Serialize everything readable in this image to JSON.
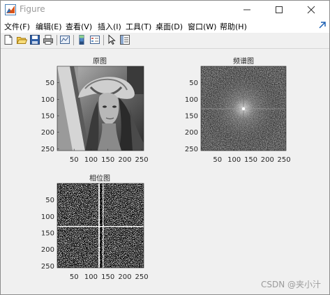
{
  "window": {
    "title": "Figure"
  },
  "menu": [
    "文件(F)",
    "编辑(E)",
    "查看(V)",
    "插入(I)",
    "工具(T)",
    "桌面(D)",
    "窗口(W)",
    "帮助(H)"
  ],
  "toolbar": [
    "new-figure-icon",
    "open-folder-icon",
    "save-icon",
    "print-icon",
    "link-plot-icon",
    "colorbar-icon",
    "legend-icon",
    "pointer-icon",
    "property-inspector-icon"
  ],
  "plots": [
    {
      "title": "原图",
      "yticks": [
        "50",
        "100",
        "150",
        "200",
        "250"
      ],
      "xticks": [
        "50",
        "100",
        "150",
        "200",
        "250"
      ]
    },
    {
      "title": "频谱图",
      "yticks": [
        "50",
        "100",
        "150",
        "200",
        "250"
      ],
      "xticks": [
        "50",
        "100",
        "150",
        "200",
        "250"
      ]
    },
    {
      "title": "相位图",
      "yticks": [
        "50",
        "100",
        "150",
        "200",
        "250"
      ],
      "xticks": [
        "50",
        "100",
        "150",
        "200",
        "250"
      ]
    }
  ],
  "watermark": "CSDN @夹小汁"
}
